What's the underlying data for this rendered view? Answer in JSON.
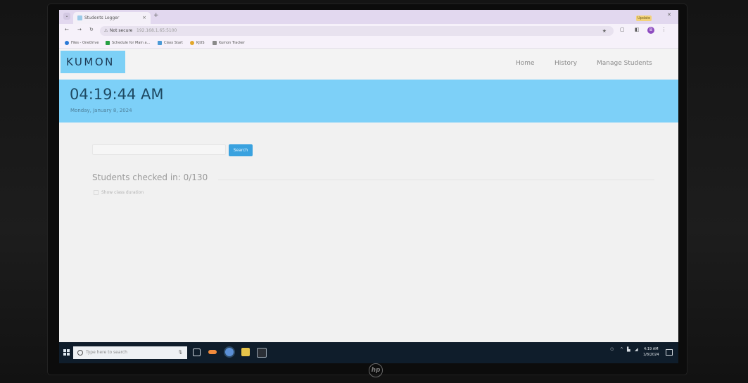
{
  "browser": {
    "tab_title": "Students Logger",
    "tab_close": "×",
    "new_tab": "+",
    "update_badge": "Update",
    "profile_initial": "B",
    "omnibox": {
      "not_secure": "Not secure",
      "url": "192.168.1.65:5100"
    },
    "bookmarks": [
      {
        "label": "Files - OneDrive",
        "color": "#2a7ad6"
      },
      {
        "label": "Schedule for Main a...",
        "color": "#27a043"
      },
      {
        "label": "Class Start",
        "color": "#4c9ad6"
      },
      {
        "label": "KJUS",
        "color": "#e2a72a"
      },
      {
        "label": "Kumon Tracker",
        "color": "#8a8a8a"
      }
    ]
  },
  "app": {
    "logo": "KUMON",
    "nav": [
      {
        "label": "Home"
      },
      {
        "label": "History"
      },
      {
        "label": "Manage Students"
      }
    ],
    "clock": {
      "time": "04:19:44 AM",
      "date": "Monday, January 8, 2024"
    },
    "search": {
      "placeholder": "",
      "button": "Search"
    },
    "checked_in_label": "Students checked in: 0/130",
    "show_duration_label": "Show class duration",
    "colors": {
      "brand_light_blue": "#7dd0f8",
      "button_blue": "#3aa2df",
      "logo_text": "#1d3a55"
    }
  },
  "taskbar": {
    "search_placeholder": "Type here to search",
    "clock_time": "4:19 AM",
    "clock_date": "1/8/2024",
    "pinned_icons": [
      "task-view-icon",
      "edge-icon",
      "chrome-icon",
      "file-explorer-icon",
      "terminal-icon"
    ]
  },
  "monitor": {
    "brand": "hp"
  }
}
